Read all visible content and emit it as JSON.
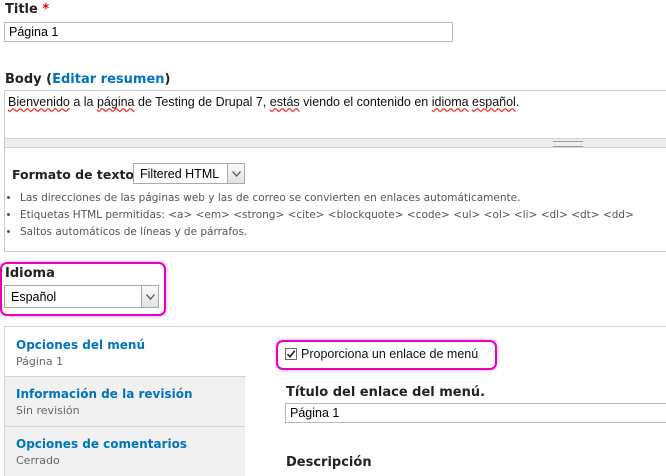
{
  "title_field": {
    "label": "Title",
    "required_mark": "*",
    "value": "Página 1"
  },
  "body_field": {
    "label": "Body",
    "open_paren": "(",
    "summary_link": "Editar resumen",
    "close_paren": ")",
    "content": {
      "p1": "Bienvenido",
      "p2": " a la ",
      "p3": "página",
      "p4": " de Testing de Drupal 7, ",
      "p5": "estás",
      "p6": " viendo el contenido en ",
      "p7": "idioma",
      "p8": " ",
      "p9": "español",
      "p10": "."
    }
  },
  "text_format": {
    "label": "Formato de texto",
    "selected": "Filtered HTML",
    "tips": [
      "Las direcciones de las páginas web y las de correo se convierten en enlaces automáticamente.",
      "Etiquetas HTML permitidas: <a> <em> <strong> <cite> <blockquote> <code> <ul> <ol> <li> <dl> <dt> <dd>",
      "Saltos automáticos de líneas y de párrafos."
    ]
  },
  "language": {
    "label": "Idioma",
    "selected": "Español"
  },
  "vertical_tabs": [
    {
      "title": "Opciones del menú",
      "summary": "Página 1"
    },
    {
      "title": "Información de la revisión",
      "summary": "Sin revisión"
    },
    {
      "title": "Opciones de comentarios",
      "summary": "Cerrado"
    }
  ],
  "menu_settings": {
    "checkbox_label": "Proporciona un enlace de menú",
    "checked": true,
    "link_title_label": "Título del enlace del menú.",
    "link_title_value": "Página 1",
    "description_label": "Descripción"
  },
  "colors": {
    "link": "#0074bd",
    "highlight": "#e600b8",
    "required": "#e00000"
  }
}
